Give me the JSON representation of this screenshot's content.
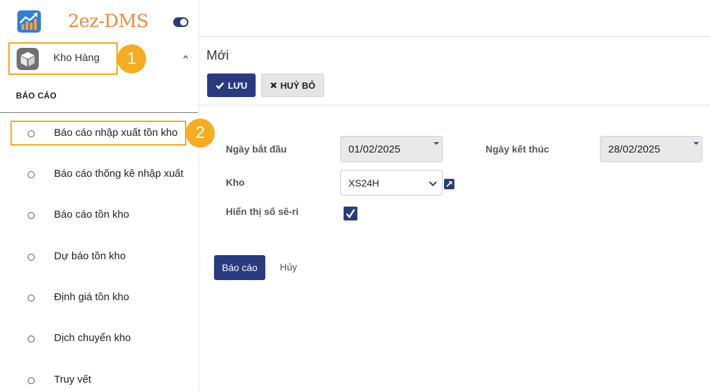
{
  "brand": {
    "name": "2ez-DMS"
  },
  "module": {
    "label": "Kho Hàng",
    "step_badge": "1"
  },
  "section": {
    "title": "BÁO CÁO"
  },
  "menu": {
    "step_badge": "2",
    "items": [
      {
        "label": "Báo cáo nhập xuất tồn kho",
        "active": true
      },
      {
        "label": "Báo cáo thống kê nhập xuất"
      },
      {
        "label": "Báo cáo tồn kho"
      },
      {
        "label": "Dự báo tồn kho"
      },
      {
        "label": "Định giá tồn kho"
      },
      {
        "label": "Dịch chuyển kho"
      },
      {
        "label": "Truy vết"
      }
    ]
  },
  "page": {
    "title": "Mới"
  },
  "toolbar": {
    "save_label": "LƯU",
    "cancel_label": "HUỶ BỎ"
  },
  "form": {
    "start_date": {
      "label": "Ngày bắt đầu",
      "value": "01/02/2025"
    },
    "end_date": {
      "label": "Ngày kết thúc",
      "value": "28/02/2025"
    },
    "warehouse": {
      "label": "Kho",
      "value": "XS24H"
    },
    "show_serial": {
      "label": "Hiển thị số sê-ri",
      "checked": true
    }
  },
  "actions": {
    "report_label": "Báo cáo",
    "cancel_label": "Hủy"
  },
  "colors": {
    "primary": "#2a3a7e",
    "highlight": "#f2a91d",
    "badge": "#f4ad23",
    "brand": "#f08a3c"
  }
}
